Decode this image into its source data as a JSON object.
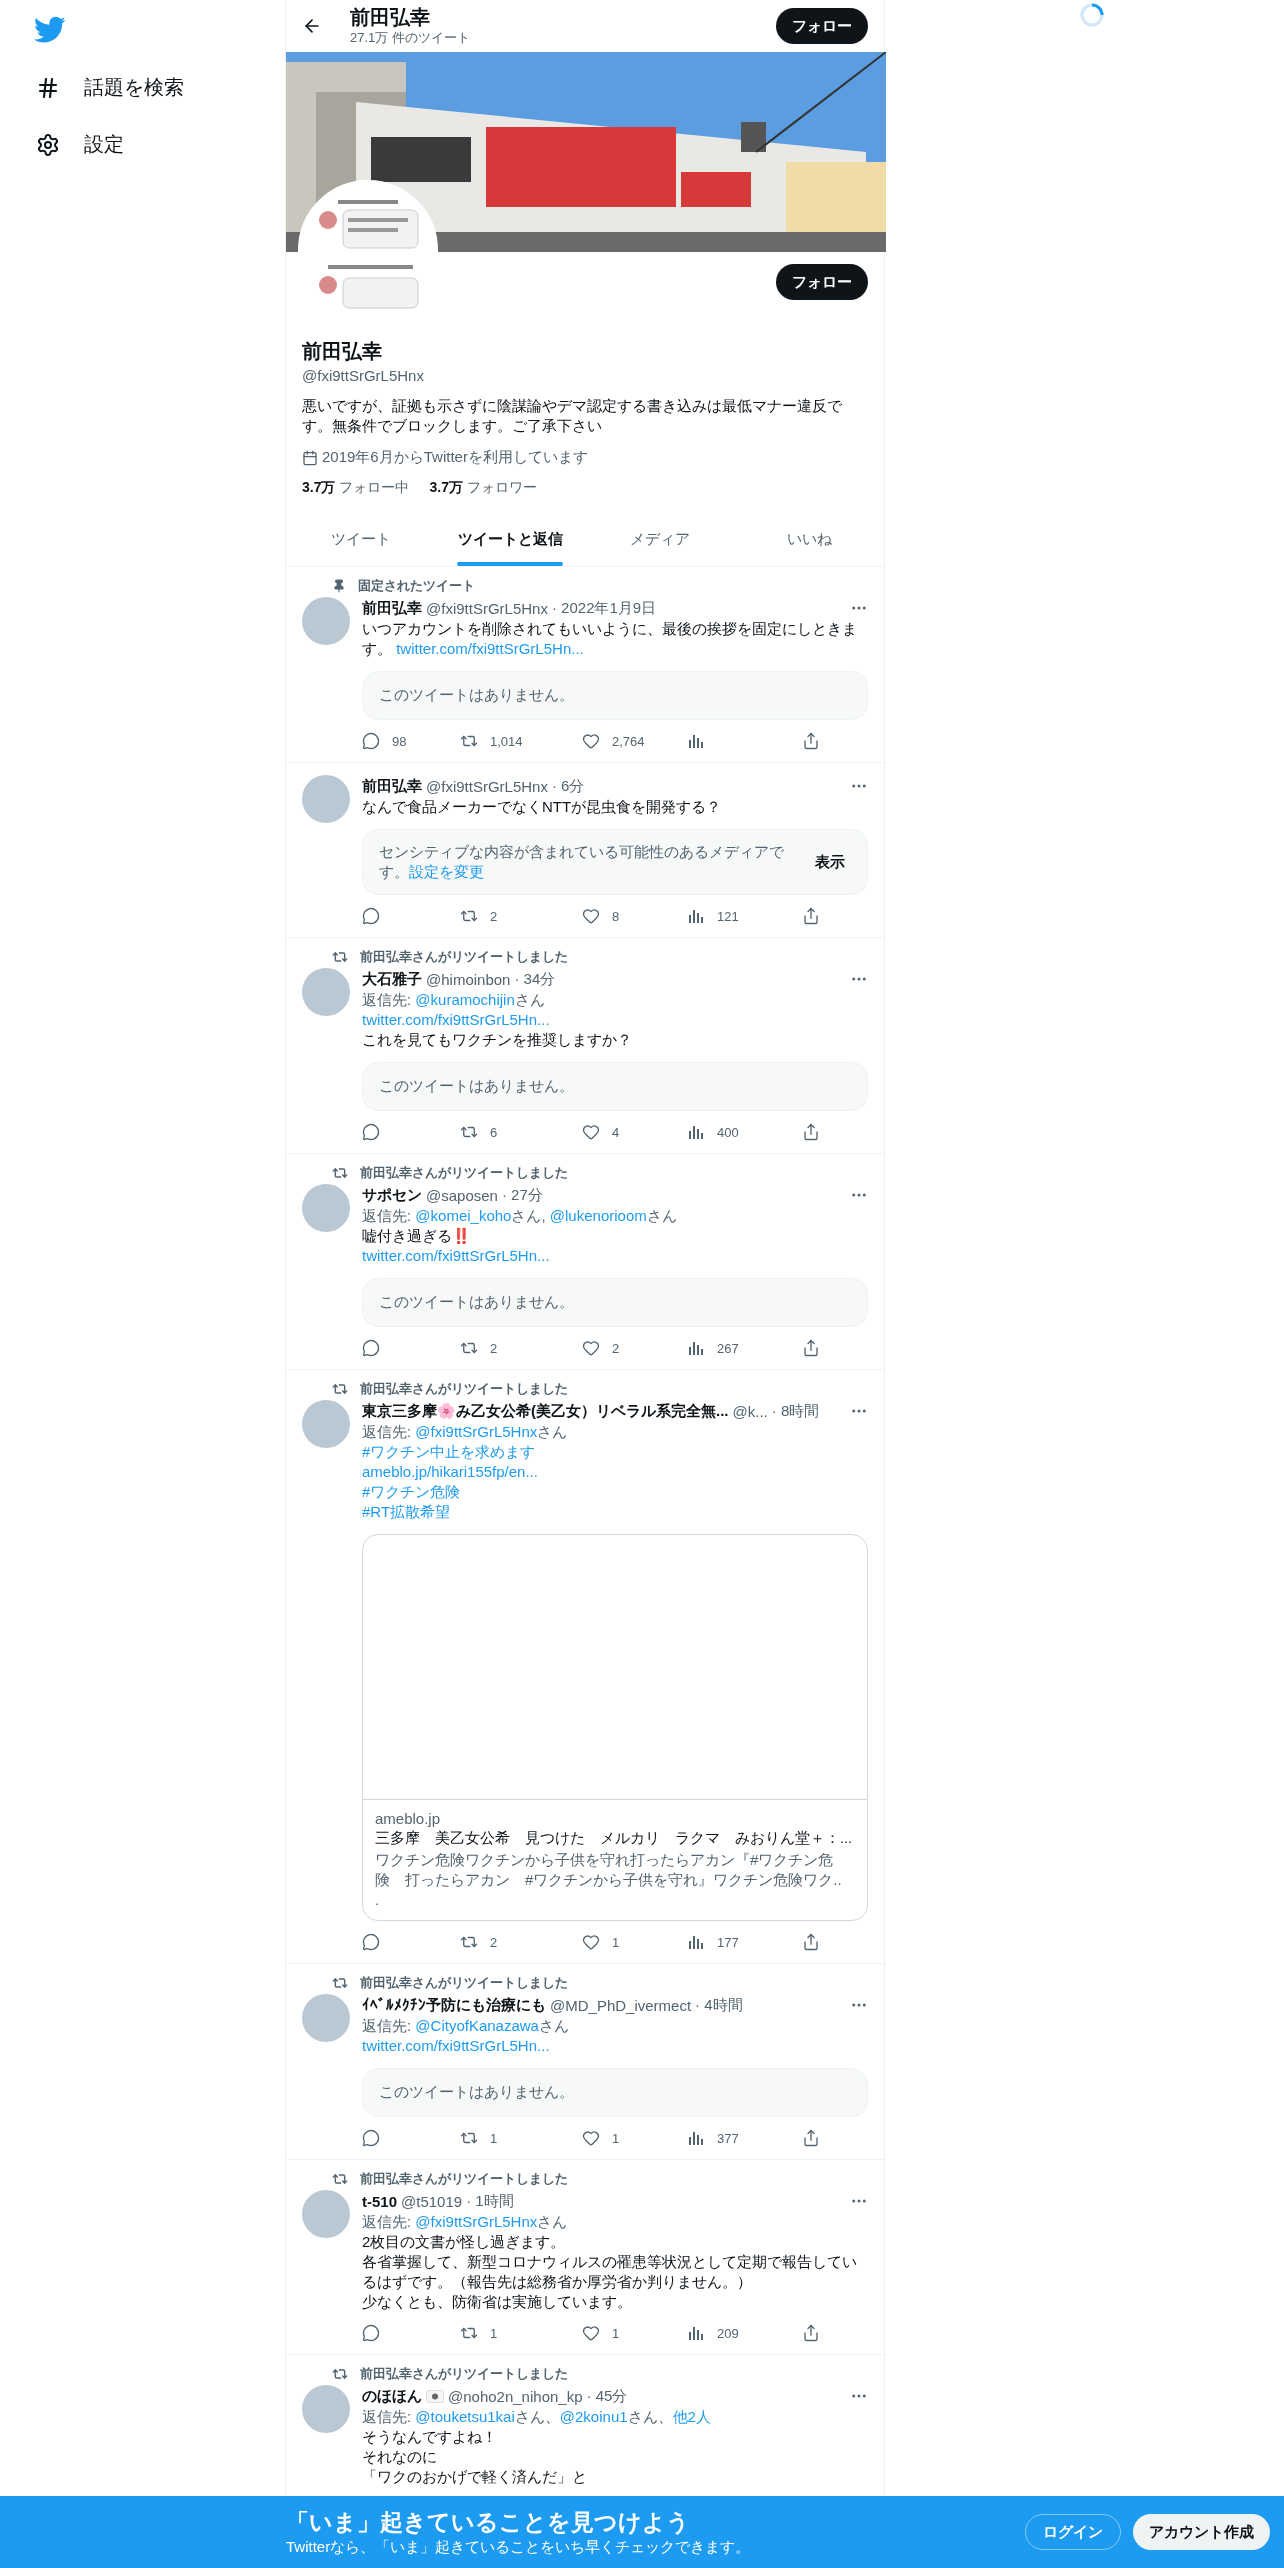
{
  "sidebar": {
    "items": [
      {
        "kind": "explore",
        "label": "話題を検索"
      },
      {
        "kind": "settings",
        "label": "設定"
      }
    ]
  },
  "header": {
    "name": "前田弘幸",
    "tweet_count": "27.1万 件のツイート",
    "follow_button": "フォロー"
  },
  "profile": {
    "follow_button": "フォロー",
    "name": "前田弘幸",
    "handle": "@fxi9ttSrGrL5Hnx",
    "bio": "悪いですが、証拠も示さずに陰謀論やデマ認定する書き込みは最低マナー違反です。無条件でブロックします。ご了承下さい",
    "joined": "2019年6月からTwitterを利用しています",
    "following_count": "3.7万",
    "following_label": "フォロー中",
    "followers_count": "3.7万",
    "followers_label": "フォロワー"
  },
  "tabs": [
    {
      "label": "ツイート",
      "selected": false
    },
    {
      "label": "ツイートと返信",
      "selected": true
    },
    {
      "label": "メディア",
      "selected": false
    },
    {
      "label": "いいね",
      "selected": false
    }
  ],
  "tweets": [
    {
      "context": {
        "kind": "pinned",
        "text": "固定されたツイート"
      },
      "name": "前田弘幸",
      "handle": "@fxi9ttSrGrL5Hnx",
      "time": "· 2022年1月9日",
      "body": [
        [
          {
            "text": "いつアカウントを削除されてもいいように、最後の挨拶を固定にしときます。 ",
            "link": false
          },
          {
            "text": "twitter.com/fxi9ttSrGrL5Hn...",
            "link": true
          }
        ]
      ],
      "quote": {
        "kind": "missing",
        "text": "このツイートはありません。"
      },
      "stats": [
        {
          "kind": "reply",
          "count": "98"
        },
        {
          "kind": "retweet",
          "count": "1,014"
        },
        {
          "kind": "like",
          "count": "2,764"
        },
        {
          "kind": "views"
        },
        {
          "kind": "share"
        }
      ]
    },
    {
      "name": "前田弘幸",
      "handle": "@fxi9ttSrGrL5Hnx",
      "time": "· 6分",
      "body": [
        [
          {
            "text": "なんで食品メーカーでなくNTTが昆虫食を開発する？",
            "link": false
          }
        ]
      ],
      "quote": {
        "kind": "sensitive",
        "text": [
          {
            "text": "センシティブな内容が含まれている可能性のあるメディアです。",
            "link": false
          },
          {
            "text": "設定を変更",
            "link": true
          }
        ],
        "button": "表示"
      },
      "stats": [
        {
          "kind": "reply"
        },
        {
          "kind": "retweet",
          "count": "2"
        },
        {
          "kind": "like",
          "count": "8"
        },
        {
          "kind": "views",
          "count": "121"
        },
        {
          "kind": "share"
        }
      ]
    },
    {
      "context": {
        "kind": "retweet",
        "text": "前田弘幸さんがリツイートしました"
      },
      "name": "大石雅子",
      "handle": "@himoinbon",
      "time": "· 34分",
      "reply_to": [
        {
          "text": "返信先: ",
          "link": false
        },
        {
          "text": "@kuramochijin",
          "link": true
        },
        {
          "text": "さん",
          "link": false
        }
      ],
      "body": [
        [
          {
            "text": "twitter.com/fxi9ttSrGrL5Hn...",
            "link": true
          }
        ],
        [
          {
            "text": "これを見てもワクチンを推奨しますか？",
            "link": false
          }
        ]
      ],
      "quote": {
        "kind": "missing",
        "text": "このツイートはありません。"
      },
      "stats": [
        {
          "kind": "reply"
        },
        {
          "kind": "retweet",
          "count": "6"
        },
        {
          "kind": "like",
          "count": "4"
        },
        {
          "kind": "views",
          "count": "400"
        },
        {
          "kind": "share"
        }
      ]
    },
    {
      "context": {
        "kind": "retweet",
        "text": "前田弘幸さんがリツイートしました"
      },
      "name": "サポセン",
      "handle": "@saposen",
      "time": "· 27分",
      "reply_to": [
        {
          "text": "返信先: ",
          "link": false
        },
        {
          "text": "@komei_koho",
          "link": true
        },
        {
          "text": "さん, ",
          "link": false
        },
        {
          "text": "@lukenorioom",
          "link": true
        },
        {
          "text": "さん",
          "link": false
        }
      ],
      "body": [
        [
          {
            "text": "嘘付き過ぎる‼️",
            "link": false
          }
        ],
        [
          {
            "text": "twitter.com/fxi9ttSrGrL5Hn...",
            "link": true
          }
        ]
      ],
      "quote": {
        "kind": "missing",
        "text": "このツイートはありません。"
      },
      "stats": [
        {
          "kind": "reply"
        },
        {
          "kind": "retweet",
          "count": "2"
        },
        {
          "kind": "like",
          "count": "2"
        },
        {
          "kind": "views",
          "count": "267"
        },
        {
          "kind": "share"
        }
      ]
    },
    {
      "context": {
        "kind": "retweet",
        "text": "前田弘幸さんがリツイートしました"
      },
      "name": "東京三多摩🌸み乙女公希(美乙女）リベラル系完全無...",
      "handle": "@k...",
      "time": "· 8時間",
      "reply_to": [
        {
          "text": "返信先: ",
          "link": false
        },
        {
          "text": "@fxi9ttSrGrL5Hnx",
          "link": true
        },
        {
          "text": "さん",
          "link": false
        }
      ],
      "body": [
        [
          {
            "text": "#ワクチン中止を求めます",
            "link": true
          }
        ],
        [
          {
            "text": "ameblo.jp/hikari155fp/en...",
            "link": true
          }
        ],
        [
          {
            "text": "#ワクチン危険",
            "link": true
          }
        ],
        [
          {
            "text": "#RT拡散希望",
            "link": true
          }
        ]
      ],
      "quote": {
        "kind": "card",
        "domain": "ameblo.jp",
        "title": "三多摩　美乙女公希　見つけた　メルカリ　ラクマ　みおりん堂＋：...",
        "description": " ワクチン危険ワクチンから子供を守れ打ったらアカン『#ワクチン危険　打ったらアカン　#ワクチンから子供を守れ』ワクチン危険ワク..."
      },
      "stats": [
        {
          "kind": "reply"
        },
        {
          "kind": "retweet",
          "count": "2"
        },
        {
          "kind": "like",
          "count": "1"
        },
        {
          "kind": "views",
          "count": "177"
        },
        {
          "kind": "share"
        }
      ]
    },
    {
      "context": {
        "kind": "retweet",
        "text": "前田弘幸さんがリツイートしました"
      },
      "name": "ｲﾍﾞﾙﾒｸﾁﾝ予防にも治療にも",
      "handle": "@MD_PhD_ivermect",
      "time": "· 4時間",
      "reply_to": [
        {
          "text": "返信先: ",
          "link": false
        },
        {
          "text": "@CityofKanazawa",
          "link": true
        },
        {
          "text": "さん",
          "link": false
        }
      ],
      "body": [
        [
          {
            "text": "twitter.com/fxi9ttSrGrL5Hn...",
            "link": true
          }
        ]
      ],
      "quote": {
        "kind": "missing",
        "text": "このツイートはありません。"
      },
      "stats": [
        {
          "kind": "reply"
        },
        {
          "kind": "retweet",
          "count": "1"
        },
        {
          "kind": "like",
          "count": "1"
        },
        {
          "kind": "views",
          "count": "377"
        },
        {
          "kind": "share"
        }
      ]
    },
    {
      "context": {
        "kind": "retweet",
        "text": "前田弘幸さんがリツイートしました"
      },
      "name": "t-510",
      "handle": "@t51019",
      "time": "· 1時間",
      "reply_to": [
        {
          "text": "返信先: ",
          "link": false
        },
        {
          "text": "@fxi9ttSrGrL5Hnx",
          "link": true
        },
        {
          "text": "さん",
          "link": false
        }
      ],
      "body": [
        [
          {
            "text": "2枚目の文書が怪し過ぎます。",
            "link": false
          }
        ],
        [
          {
            "text": "各省掌握して、新型コロナウィルスの罹患等状況として定期で報告しているはずです。（報告先は総務省か厚労省か判りません。）",
            "link": false
          }
        ],
        [
          {
            "text": "少なくとも、防衛省は実施しています。",
            "link": false
          }
        ]
      ],
      "stats": [
        {
          "kind": "reply"
        },
        {
          "kind": "retweet",
          "count": "1"
        },
        {
          "kind": "like",
          "count": "1"
        },
        {
          "kind": "views",
          "count": "209"
        },
        {
          "kind": "share"
        }
      ]
    },
    {
      "context": {
        "kind": "retweet",
        "text": "前田弘幸さんがリツイートしました"
      },
      "name": "のほほん",
      "name_flag": true,
      "handle": "@noho2n_nihon_kp",
      "time": "· 45分",
      "reply_to": [
        {
          "text": "返信先: ",
          "link": false
        },
        {
          "text": "@touketsu1kai",
          "link": true
        },
        {
          "text": "さん、",
          "link": false
        },
        {
          "text": "@2koinu1",
          "link": true
        },
        {
          "text": "さん、",
          "link": false
        },
        {
          "text": "他2人",
          "link": true
        }
      ],
      "body": [
        [
          {
            "text": "そうなんですよね！",
            "link": false
          }
        ],
        [
          {
            "text": "それなのに",
            "link": false
          }
        ],
        [
          {
            "text": "「ワクのおかげで軽く済んだ」と",
            "link": false
          }
        ]
      ]
    }
  ],
  "signup_bar": {
    "title": "「いま」起きていることを見つけよう",
    "subtitle": "Twitterなら、「いま」起きていることをいち早くチェックできます。",
    "login_button": "ログイン",
    "signup_button": "アカウント作成"
  }
}
